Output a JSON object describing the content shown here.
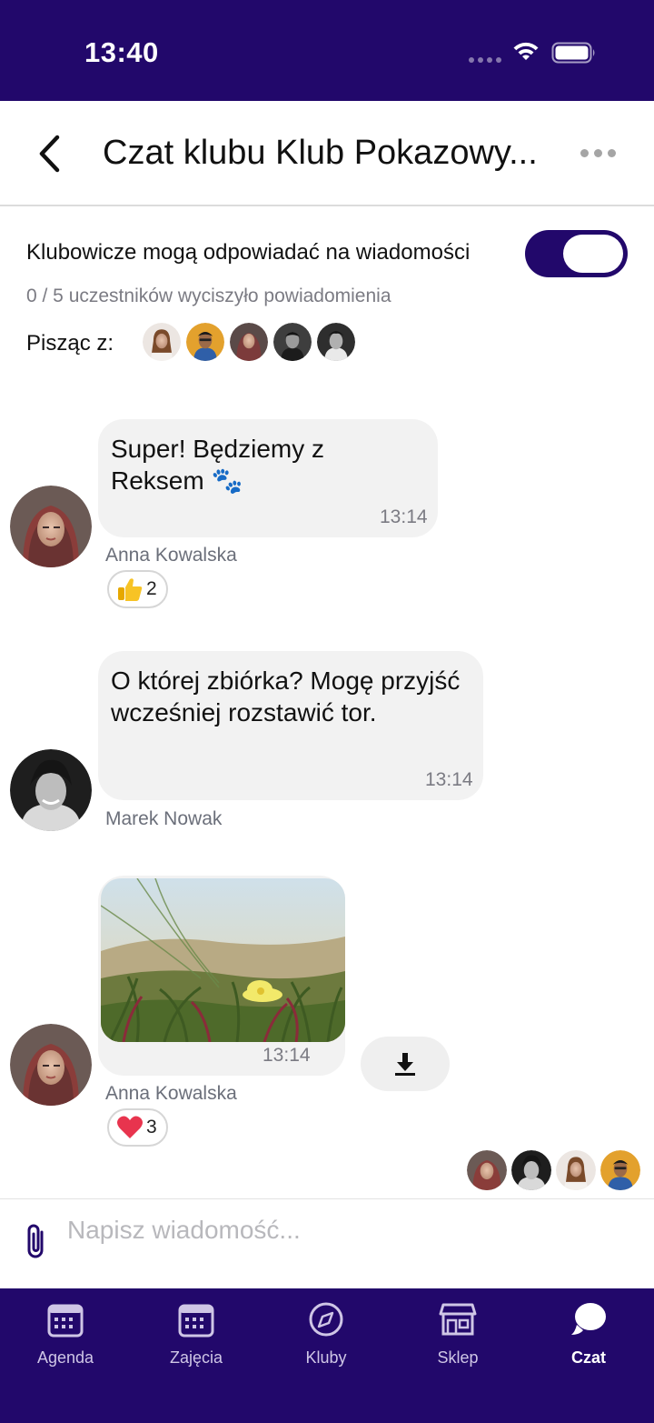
{
  "status_bar": {
    "time": "13:40"
  },
  "header": {
    "title": "Czat klubu Klub Pokazowy..."
  },
  "settings": {
    "reply_toggle_label": "Klubowicze mogą odpowiadać na wiadomości",
    "reply_toggle_on": true,
    "muted_info": "0 / 5 uczestników wyciszyło powiadomienia",
    "writing_with_label": "Pisząc z:"
  },
  "messages": [
    {
      "text": "Super! Będziemy z Reksem 🐾",
      "time": "13:14",
      "sender": "Anna Kowalska",
      "reaction": {
        "emoji": "thumbs-up",
        "count": "2"
      }
    },
    {
      "text": "O której zbiórka? Mogę przyjść wcześniej rozstawić tor.",
      "time": "13:14",
      "sender": "Marek Nowak"
    },
    {
      "type": "image",
      "time": "13:14",
      "sender": "Anna Kowalska",
      "reaction": {
        "emoji": "heart",
        "count": "3"
      }
    }
  ],
  "input": {
    "placeholder": "Napisz wiadomość..."
  },
  "tabs": [
    {
      "label": "Agenda",
      "icon": "calendar-icon"
    },
    {
      "label": "Zajęcia",
      "icon": "calendar-icon"
    },
    {
      "label": "Kluby",
      "icon": "compass-icon"
    },
    {
      "label": "Sklep",
      "icon": "store-icon"
    },
    {
      "label": "Czat",
      "icon": "chat-icon",
      "active": true
    }
  ],
  "colors": {
    "brand": "#22086b",
    "bubble": "#f2f2f2",
    "muted_text": "#7b7b83"
  }
}
